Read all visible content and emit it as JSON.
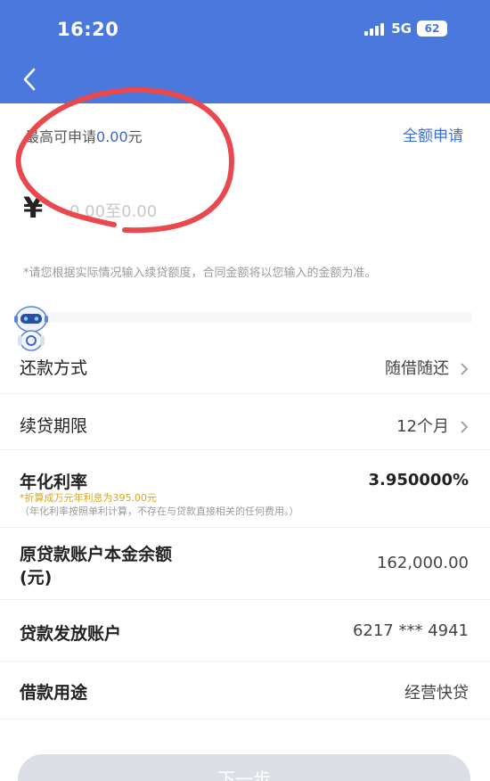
{
  "status_bar": {
    "time": "16:20",
    "network": "5G",
    "battery": "62"
  },
  "quota": {
    "label_prefix": "最高可申请",
    "amount": "0.00",
    "unit": "元",
    "full_apply_label": "全额申请"
  },
  "amount_field": {
    "currency_symbol": "¥",
    "placeholder": "0.00至0.00",
    "value": ""
  },
  "tip": "*请您根据实际情况输入续贷额度，合同金额将以您输入的金额为准。",
  "rows": {
    "repayment": {
      "label": "还款方式",
      "value": "随借随还"
    },
    "term": {
      "label": "续贷期限",
      "value": "12个月"
    },
    "rate": {
      "label": "年化利率",
      "value": "3.950000%",
      "note1": "*折算成万元年利息为395.00元",
      "note2": "（年化利率按照单利计算，不存在与贷款直接相关的任何费用。）"
    },
    "principal": {
      "label_line1": "原贷款账户本金余额",
      "label_line2": "(元)",
      "value": "162,000.00"
    },
    "account": {
      "label": "贷款发放账户",
      "value": "6217 *** 4941"
    },
    "purpose": {
      "label": "借款用途",
      "value": "经营快贷"
    }
  },
  "next_button": {
    "label": "下一步"
  },
  "colors": {
    "header": "#4a78dd",
    "link": "#3f6ed8",
    "note": "#d9a520",
    "annotation": "#e8484e"
  }
}
